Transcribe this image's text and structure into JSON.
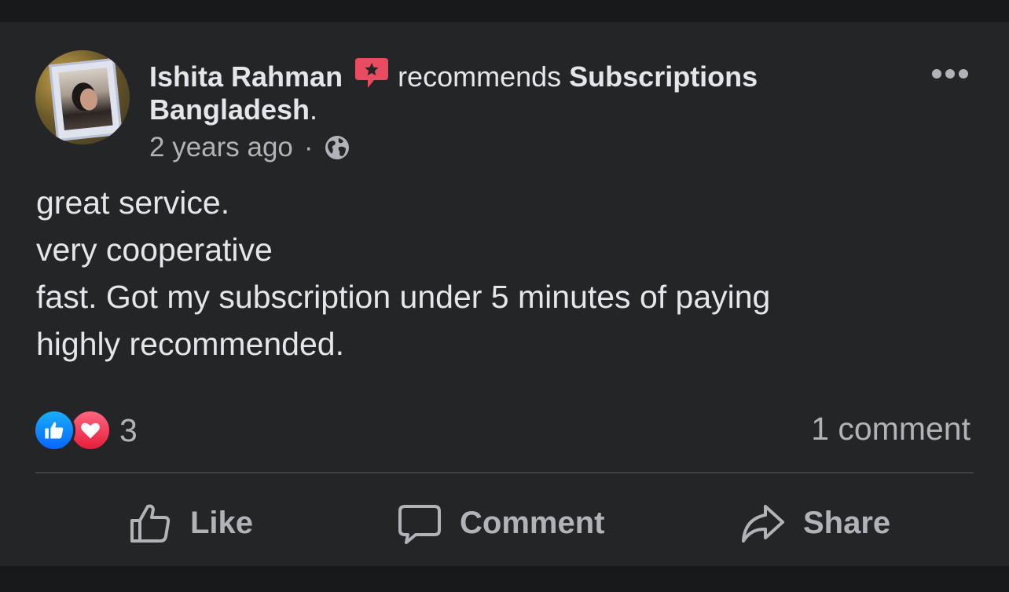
{
  "post": {
    "author": "Ishita Rahman",
    "action": "recommends",
    "page_name_line1": "Subscriptions",
    "page_name_line2": "Bangladesh",
    "period": ".",
    "time": "2 years ago",
    "separator": "·",
    "privacy_icon": "globe-icon",
    "body_lines": [
      "great service.",
      "very cooperative",
      "fast. Got my subscription under 5 minutes of paying",
      "highly recommended."
    ]
  },
  "reactions": {
    "icons": [
      "like-reaction-icon",
      "love-reaction-icon"
    ],
    "count": "3"
  },
  "comments": {
    "label": "1 comment"
  },
  "actions": {
    "like": "Like",
    "comment": "Comment",
    "share": "Share"
  },
  "colors": {
    "background": "#18191a",
    "card": "#242526",
    "text": "#e4e6eb",
    "secondary": "#b0b3b8",
    "recommend_badge": "#e94b60",
    "like_blue": "#0866ff",
    "love_red": "#e61e3c"
  }
}
